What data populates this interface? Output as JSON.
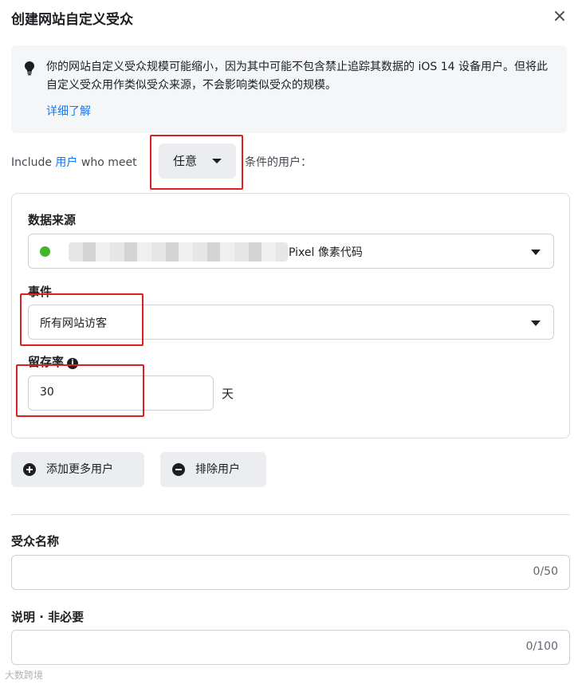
{
  "header": {
    "title": "创建网站自定义受众",
    "close_icon": "close-icon",
    "close_glyph": "×"
  },
  "notice": {
    "text": "你的网站自定义受众规模可能缩小，因为其中可能不包含禁止追踪其数据的 iOS 14 设备用户。但将此自定义受众用作类似受众来源，不会影响类似受众的规模。",
    "link": "详细了解",
    "icon": "lightbulb-icon"
  },
  "include": {
    "prefix": "Include",
    "users_link": "用户",
    "who_meet": "who meet",
    "selected": "任意",
    "suffix": "条件的用户："
  },
  "rule": {
    "source_label": "数据来源",
    "source_value": "Pixel 像素代码",
    "source_status_color": "#42b72a",
    "event_label": "事件",
    "event_value": "所有网站访客",
    "retention_label": "留存率",
    "retention_value": "30",
    "retention_unit": "天"
  },
  "actions": {
    "add_more": "添加更多用户",
    "exclude": "排除用户"
  },
  "audience_name": {
    "label": "受众名称",
    "value": "",
    "counter": "0/50"
  },
  "description": {
    "label": "说明 · 非必要",
    "value": "",
    "counter": "0/100"
  },
  "watermark": "大数跨境",
  "colors": {
    "accent": "#1877f2",
    "highlight": "#e02020"
  }
}
